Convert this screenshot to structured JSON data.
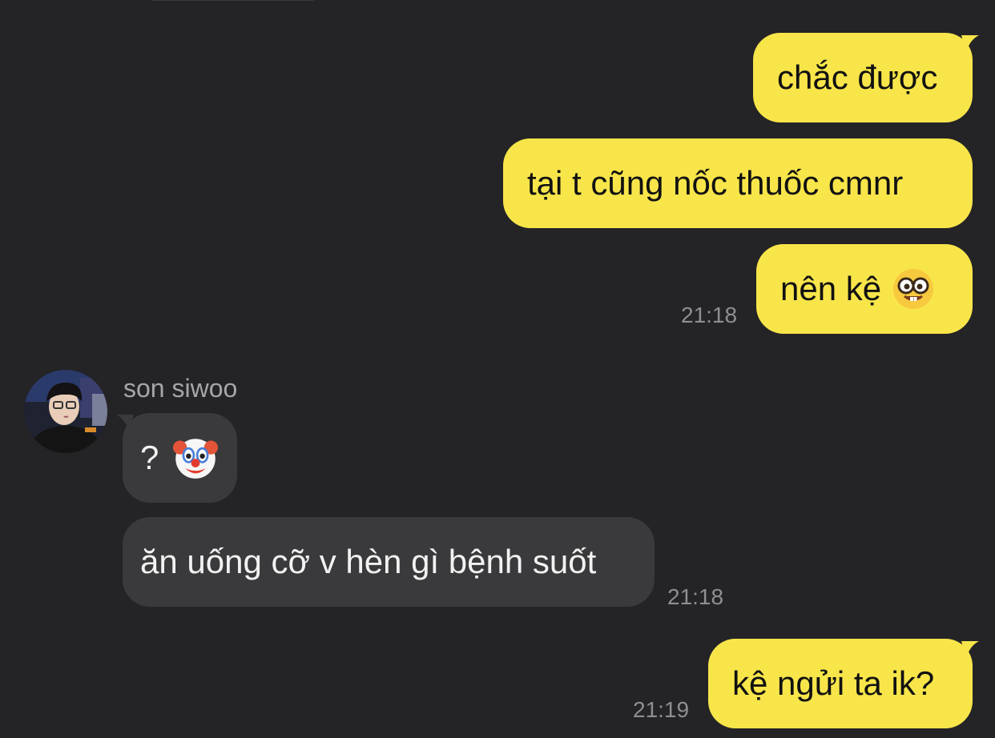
{
  "messages": {
    "m1": {
      "text": "chắc được"
    },
    "m2": {
      "text": "tại t cũng nốc thuốc cmnr"
    },
    "m3": {
      "text": "nên kệ",
      "emoji": "nerd-face-icon",
      "time": "21:18"
    },
    "sender_name": "son siwoo",
    "m4": {
      "text": "?",
      "emoji": "clown-face-icon"
    },
    "m5": {
      "text": "ăn uống cỡ v hèn gì bệnh suốt",
      "time": "21:18"
    },
    "m6": {
      "text": "kệ ngửi ta ik?",
      "time": "21:19"
    }
  },
  "colors": {
    "background": "#242426",
    "outgoing_bubble": "#f8e54a",
    "incoming_bubble": "#3a3a3c",
    "timestamp": "#8e8e93"
  }
}
